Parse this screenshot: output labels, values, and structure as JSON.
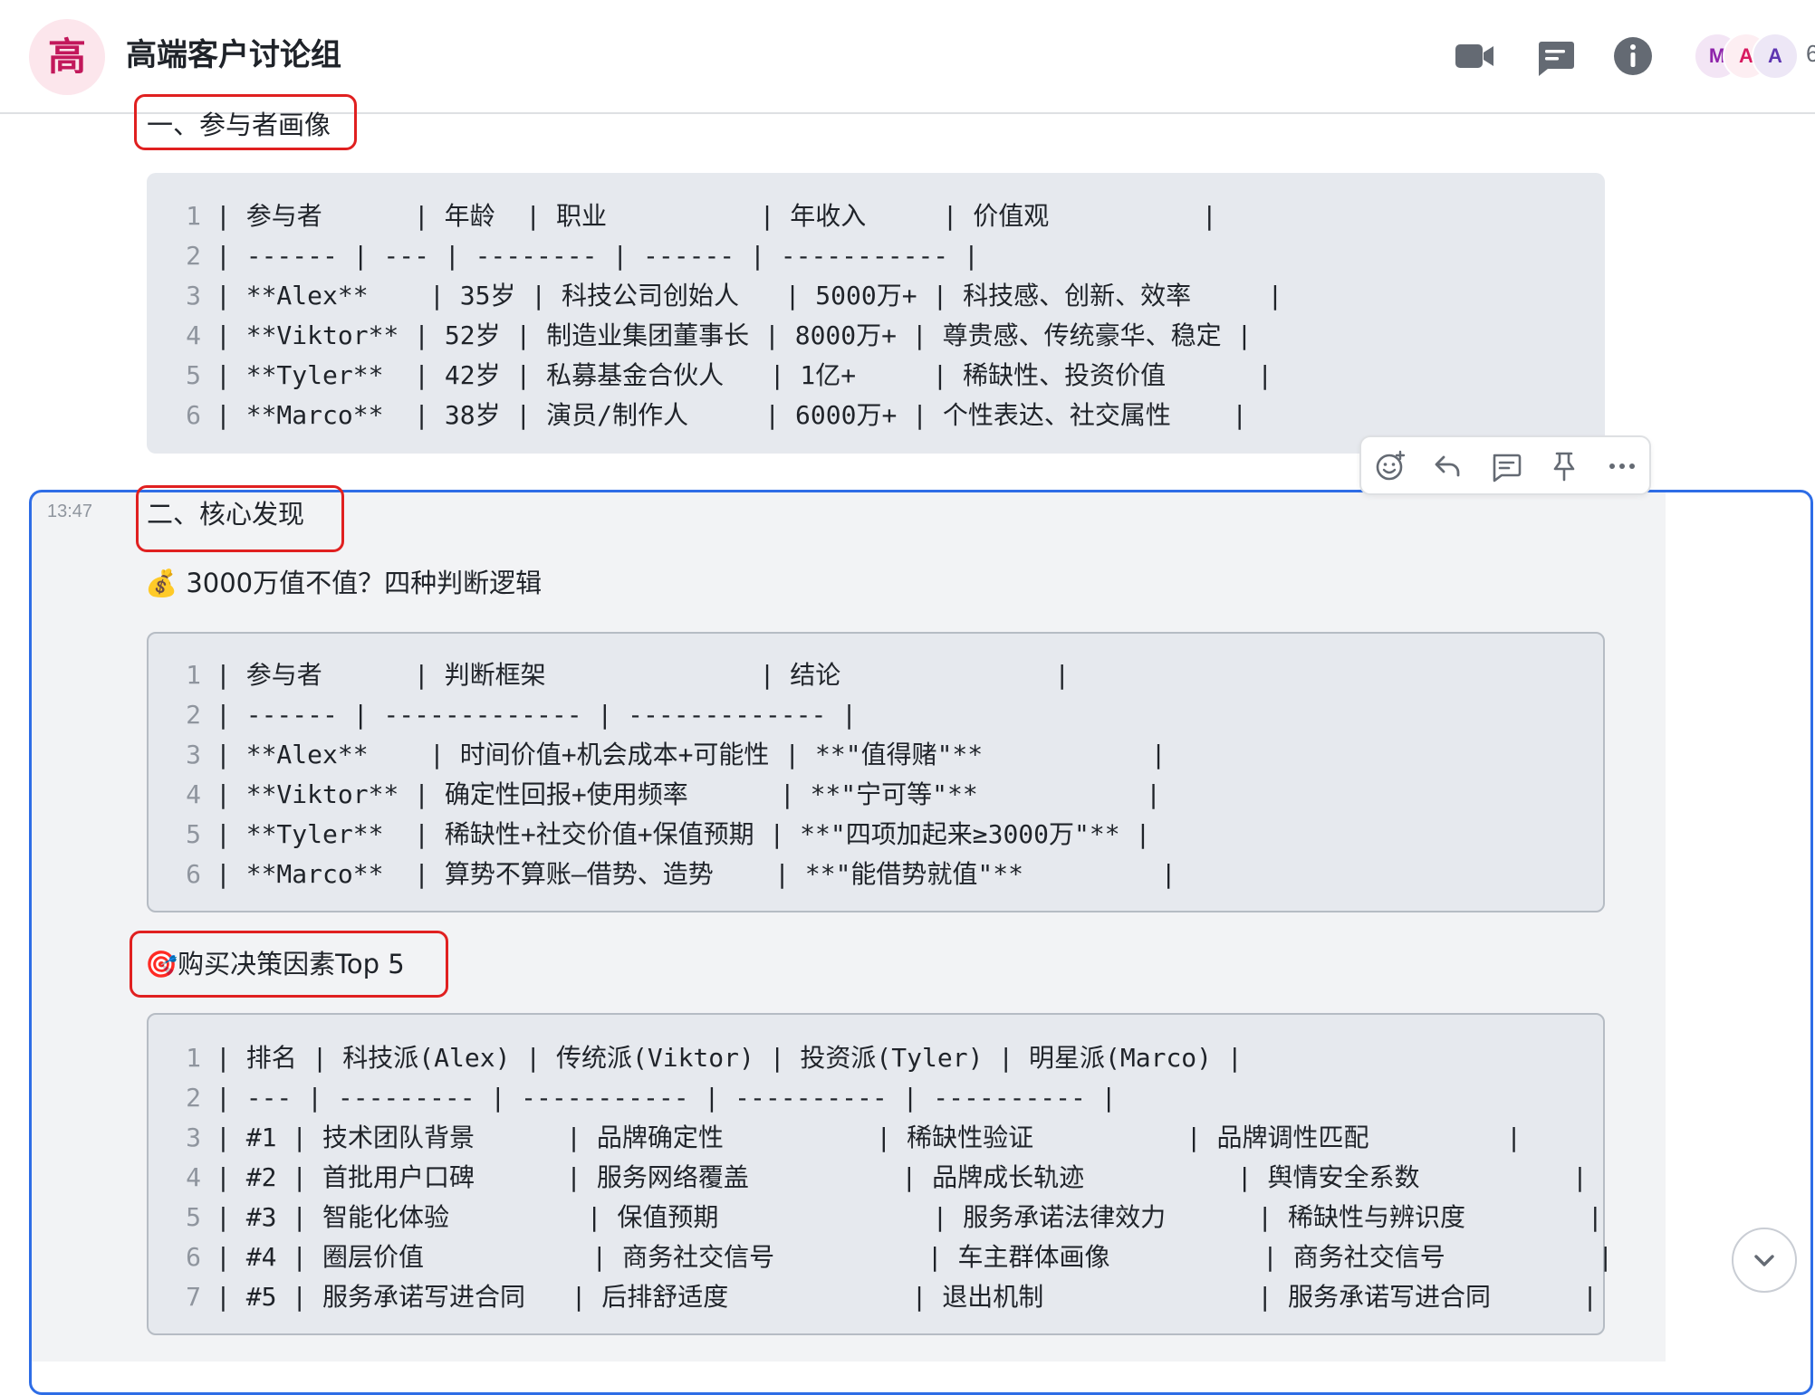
{
  "header": {
    "avatar_char": "高",
    "group_name": "高端客户讨论组",
    "member_initials": [
      "M",
      "A",
      "A"
    ],
    "member_count": "6",
    "icons": [
      "video-call-icon",
      "chat-thread-icon",
      "info-icon"
    ]
  },
  "section1": {
    "title": "一、参与者画像",
    "code": [
      {
        "n": "1",
        "text": "| 参与者      | 年龄  | 职业          | 年收入     | 价值观          |"
      },
      {
        "n": "2",
        "text": "| ------ | --- | -------- | ------ | ----------- |"
      },
      {
        "n": "3",
        "text": "| **Alex**    | 35岁 | 科技公司创始人   | 5000万+ | 科技感、创新、效率     |"
      },
      {
        "n": "4",
        "text": "| **Viktor** | 52岁 | 制造业集团董事长 | 8000万+ | 尊贵感、传统豪华、稳定 |"
      },
      {
        "n": "5",
        "text": "| **Tyler**  | 42岁 | 私募基金合伙人   | 1亿+     | 稀缺性、投资价值      |"
      },
      {
        "n": "6",
        "text": "| **Marco**  | 38岁 | 演员/制作人     | 6000万+ | 个性表达、社交属性    |"
      }
    ]
  },
  "message": {
    "time": "13:47",
    "section2_title": "二、核心发现",
    "subtitle_emoji": "💰",
    "subtitle": "3000万值不值？四种判断逻辑",
    "code2": [
      {
        "n": "1",
        "text": "| 参与者      | 判断框架              | 结论              |"
      },
      {
        "n": "2",
        "text": "| ------ | ------------- | ------------- |"
      },
      {
        "n": "3",
        "text": "| **Alex**    | 时间价值+机会成本+可能性 | **\"值得赌\"**           |"
      },
      {
        "n": "4",
        "text": "| **Viktor** | 确定性回报+使用频率      | **\"宁可等\"**           |"
      },
      {
        "n": "5",
        "text": "| **Tyler**  | 稀缺性+社交价值+保值预期 | **\"四项加起来≥3000万\"** |"
      },
      {
        "n": "6",
        "text": "| **Marco**  | 算势不算账—借势、造势    | **\"能借势就值\"**         |"
      }
    ],
    "top5_emoji": "🎯",
    "top5_title": "购买决策因素Top 5",
    "code3": [
      {
        "n": "1",
        "text": "| 排名 | 科技派(Alex) | 传统派(Viktor) | 投资派(Tyler) | 明星派(Marco) |"
      },
      {
        "n": "2",
        "text": "| --- | --------- | ----------- | ---------- | ---------- |"
      },
      {
        "n": "3",
        "text": "| #1 | 技术团队背景      | 品牌确定性          | 稀缺性验证          | 品牌调性匹配         |"
      },
      {
        "n": "4",
        "text": "| #2 | 首批用户口碑      | 服务网络覆盖          | 品牌成长轨迹          | 舆情安全系数          |"
      },
      {
        "n": "5",
        "text": "| #3 | 智能化体验         | 保值预期              | 服务承诺法律效力      | 稀缺性与辨识度        |"
      },
      {
        "n": "6",
        "text": "| #4 | 圈层价值           | 商务社交信号          | 车主群体画像          | 商务社交信号          |"
      },
      {
        "n": "7",
        "text": "| #5 | 服务承诺写进合同   | 后排舒适度            | 退出机制              | 服务承诺写进合同      |"
      }
    ]
  },
  "toolbar": [
    "add-reaction-icon",
    "reply-icon",
    "thread-comment-icon",
    "pin-icon",
    "more-icon"
  ],
  "colors": {
    "accent": "#2e6de6",
    "annotation": "#e02020",
    "avatar_bg": "#fce6ec",
    "code_bg": "#e6e9ee"
  }
}
